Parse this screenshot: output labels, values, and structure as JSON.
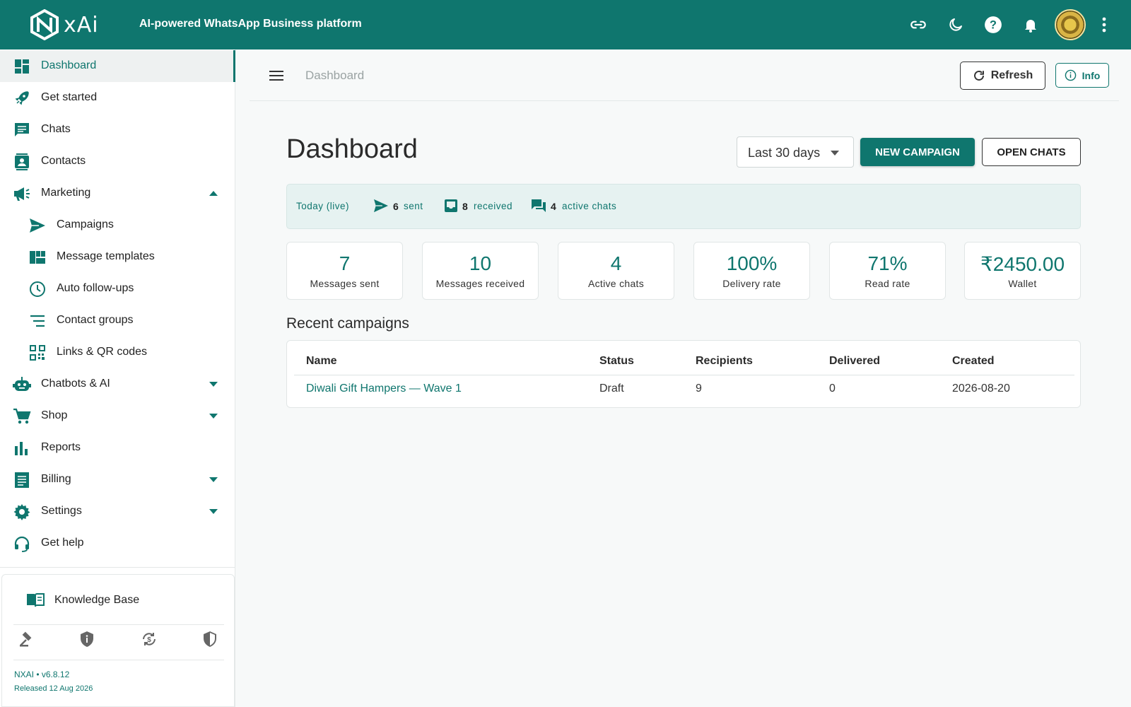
{
  "app": {
    "logo_text": "xAi",
    "tagline": "AI-powered WhatsApp Business platform"
  },
  "colors": {
    "brand": "#0f766e",
    "active_bg": "#eef1f1",
    "live_bar_bg": "#e6f2f1"
  },
  "topbar_icons": [
    "link-icon",
    "moon-icon",
    "help-icon",
    "bell-icon",
    "avatar",
    "more-vert-icon"
  ],
  "sidebar": {
    "items": [
      {
        "label": "Dashboard",
        "icon": "dashboard-icon",
        "active": true
      },
      {
        "label": "Get started",
        "icon": "rocket-icon"
      },
      {
        "label": "Chats",
        "icon": "chat-icon"
      },
      {
        "label": "Contacts",
        "icon": "contacts-icon"
      },
      {
        "label": "Marketing",
        "icon": "megaphone-icon",
        "expanded": true
      },
      {
        "label": "Campaigns",
        "icon": "send-icon"
      },
      {
        "label": "Message templates",
        "icon": "templates-icon"
      },
      {
        "label": "Auto follow-ups",
        "icon": "clock-icon"
      },
      {
        "label": "Contact groups",
        "icon": "list-icon"
      },
      {
        "label": "Links & QR codes",
        "icon": "qr-icon"
      },
      {
        "label": "Chatbots & AI",
        "icon": "robot-icon"
      },
      {
        "label": "Shop",
        "icon": "cart-icon"
      },
      {
        "label": "Reports",
        "icon": "bar-chart-icon"
      },
      {
        "label": "Billing",
        "icon": "receipt-icon"
      },
      {
        "label": "Settings",
        "icon": "gear-icon"
      },
      {
        "label": "Get help",
        "icon": "headset-icon"
      }
    ],
    "knowledge_base": "Knowledge Base",
    "footer_icons": [
      "gavel-icon",
      "privacy-icon",
      "refund-icon",
      "security-icon"
    ],
    "version": "NXAI • v6.8.12",
    "released": "Released 12 Aug 2026"
  },
  "header": {
    "breadcrumb": "Dashboard",
    "refresh_label": "Refresh",
    "info_label": "Info"
  },
  "main": {
    "title": "Dashboard",
    "range": "Last 30 days",
    "new_campaign": "NEW CAMPAIGN",
    "open_chats": "OPEN CHATS",
    "live": {
      "label": "Today (live)",
      "sent_count": "6",
      "sent_label": "sent",
      "received_count": "8",
      "received_label": "received",
      "active_count": "4",
      "active_label": "active chats"
    },
    "stats": [
      {
        "value": "7",
        "label": "Messages sent"
      },
      {
        "value": "10",
        "label": "Messages received"
      },
      {
        "value": "4",
        "label": "Active chats"
      },
      {
        "value": "100%",
        "label": "Delivery rate"
      },
      {
        "value": "71%",
        "label": "Read rate"
      },
      {
        "value": "₹2450.00",
        "label": "Wallet"
      }
    ],
    "recent_title": "Recent campaigns",
    "table": {
      "headers": [
        "Name",
        "Status",
        "Recipients",
        "Delivered",
        "Created"
      ],
      "rows": [
        [
          "Diwali Gift Hampers — Wave 1",
          "Draft",
          "9",
          "0",
          "2026-08-20"
        ]
      ]
    }
  }
}
